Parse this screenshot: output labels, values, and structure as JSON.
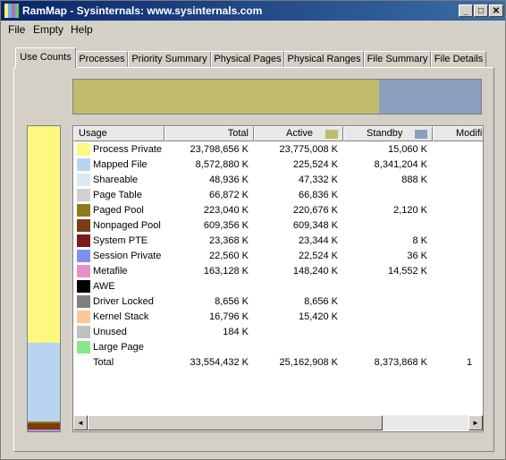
{
  "window": {
    "title": "RamMap - Sysinternals: www.sysinternals.com",
    "minimize": "_",
    "maximize": "□",
    "close": "✕"
  },
  "menu": [
    "File",
    "Empty",
    "Help"
  ],
  "tabs": [
    "Use Counts",
    "Processes",
    "Priority Summary",
    "Physical Pages",
    "Physical Ranges",
    "File Summary",
    "File Details"
  ],
  "summary_bar": {
    "active_color": "#c0bc6c",
    "standby_color": "#8aa0be",
    "active_fraction": 0.75
  },
  "columns": {
    "usage": "Usage",
    "total": "Total",
    "active": "Active",
    "standby": "Standby",
    "modified": "Modifi"
  },
  "rows": [
    {
      "usage": "Process Private",
      "color": "#fff880",
      "total": "23,798,656 K",
      "active": "23,775,008 K",
      "standby": "15,060 K",
      "modified": ""
    },
    {
      "usage": "Mapped File",
      "color": "#b8d4f0",
      "total": "8,572,880 K",
      "active": "225,524 K",
      "standby": "8,341,204 K",
      "modified": ""
    },
    {
      "usage": "Shareable",
      "color": "#dce8f4",
      "total": "48,936 K",
      "active": "47,332 K",
      "standby": "888 K",
      "modified": ""
    },
    {
      "usage": "Page Table",
      "color": "#d0d0d0",
      "total": "66,872 K",
      "active": "66,836 K",
      "standby": "",
      "modified": ""
    },
    {
      "usage": "Paged Pool",
      "color": "#8b7c1c",
      "total": "223,040 K",
      "active": "220,676 K",
      "standby": "2,120 K",
      "modified": ""
    },
    {
      "usage": "Nonpaged Pool",
      "color": "#7a3c10",
      "total": "609,356 K",
      "active": "609,348 K",
      "standby": "",
      "modified": ""
    },
    {
      "usage": "System PTE",
      "color": "#7a1c1c",
      "total": "23,368 K",
      "active": "23,344 K",
      "standby": "8 K",
      "modified": ""
    },
    {
      "usage": "Session Private",
      "color": "#8090f0",
      "total": "22,560 K",
      "active": "22,524 K",
      "standby": "36 K",
      "modified": ""
    },
    {
      "usage": "Metafile",
      "color": "#e890c8",
      "total": "163,128 K",
      "active": "148,240 K",
      "standby": "14,552 K",
      "modified": ""
    },
    {
      "usage": "AWE",
      "color": "#000000",
      "total": "",
      "active": "",
      "standby": "",
      "modified": ""
    },
    {
      "usage": "Driver Locked",
      "color": "#808080",
      "total": "8,656 K",
      "active": "8,656 K",
      "standby": "",
      "modified": ""
    },
    {
      "usage": "Kernel Stack",
      "color": "#f8c898",
      "total": "16,796 K",
      "active": "15,420 K",
      "standby": "",
      "modified": ""
    },
    {
      "usage": "Unused",
      "color": "#c0c0c0",
      "total": "184 K",
      "active": "",
      "standby": "",
      "modified": ""
    },
    {
      "usage": "Large Page",
      "color": "#88e888",
      "total": "",
      "active": "",
      "standby": "",
      "modified": ""
    },
    {
      "usage": "Total",
      "color": "",
      "total": "33,554,432 K",
      "active": "25,162,908 K",
      "standby": "8,373,868 K",
      "modified": "1"
    }
  ],
  "vertical_bar": [
    {
      "usage": "Process Private",
      "color": "#fff880",
      "fraction": 0.7092
    },
    {
      "usage": "Mapped File",
      "color": "#b8d4f0",
      "fraction": 0.2555
    },
    {
      "usage": "Shareable",
      "color": "#dce8f4",
      "fraction": 0.0015
    },
    {
      "usage": "Page Table",
      "color": "#d0d0d0",
      "fraction": 0.002
    },
    {
      "usage": "Paged Pool",
      "color": "#8b7c1c",
      "fraction": 0.0066
    },
    {
      "usage": "Nonpaged Pool",
      "color": "#7a3c10",
      "fraction": 0.0182
    },
    {
      "usage": "Metafile",
      "color": "#e890c8",
      "fraction": 0.0049
    },
    {
      "usage": "Other",
      "color": "#8090f0",
      "fraction": 0.0021
    }
  ],
  "scroll": {
    "left": "◄",
    "right": "►"
  }
}
